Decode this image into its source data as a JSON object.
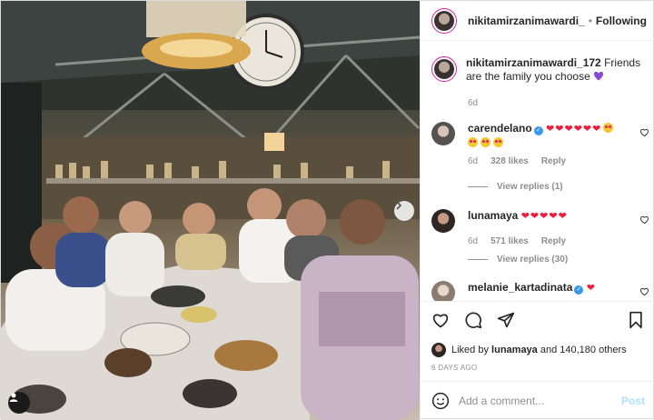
{
  "post": {
    "author": "nikitamirzanimawardi_",
    "follow_state": "Following",
    "caption_author": "nikitamirzanimawardi_172",
    "caption_text": "Friends are the family you choose",
    "caption_emoji": "purple-heart",
    "caption_time": "6d"
  },
  "comments": [
    {
      "username": "carendelano",
      "verified": true,
      "text": "❤❤❤❤❤❤",
      "time": "6d",
      "likes": "328 likes",
      "reply_label": "Reply",
      "view_replies": "View replies (1)"
    },
    {
      "username": "lunamaya",
      "verified": false,
      "text": "❤❤❤❤❤",
      "time": "6d",
      "likes": "571 likes",
      "reply_label": "Reply",
      "view_replies": "View replies (30)"
    },
    {
      "username": "melanie_kartadinata",
      "verified": true,
      "text": "❤"
    }
  ],
  "actions": {
    "liked_by_prefix": "Liked by",
    "liked_by_user": "lunamaya",
    "liked_by_suffix": "and 140,180 others",
    "date": "6 DAYS AGO"
  },
  "composer": {
    "placeholder": "Add a comment...",
    "post_label": "Post"
  },
  "colors": {
    "heart_red": "#ed1c3a",
    "link_blue": "#3897f0",
    "post_disabled": "#b2dffc",
    "story_ring": "#d6249f"
  }
}
